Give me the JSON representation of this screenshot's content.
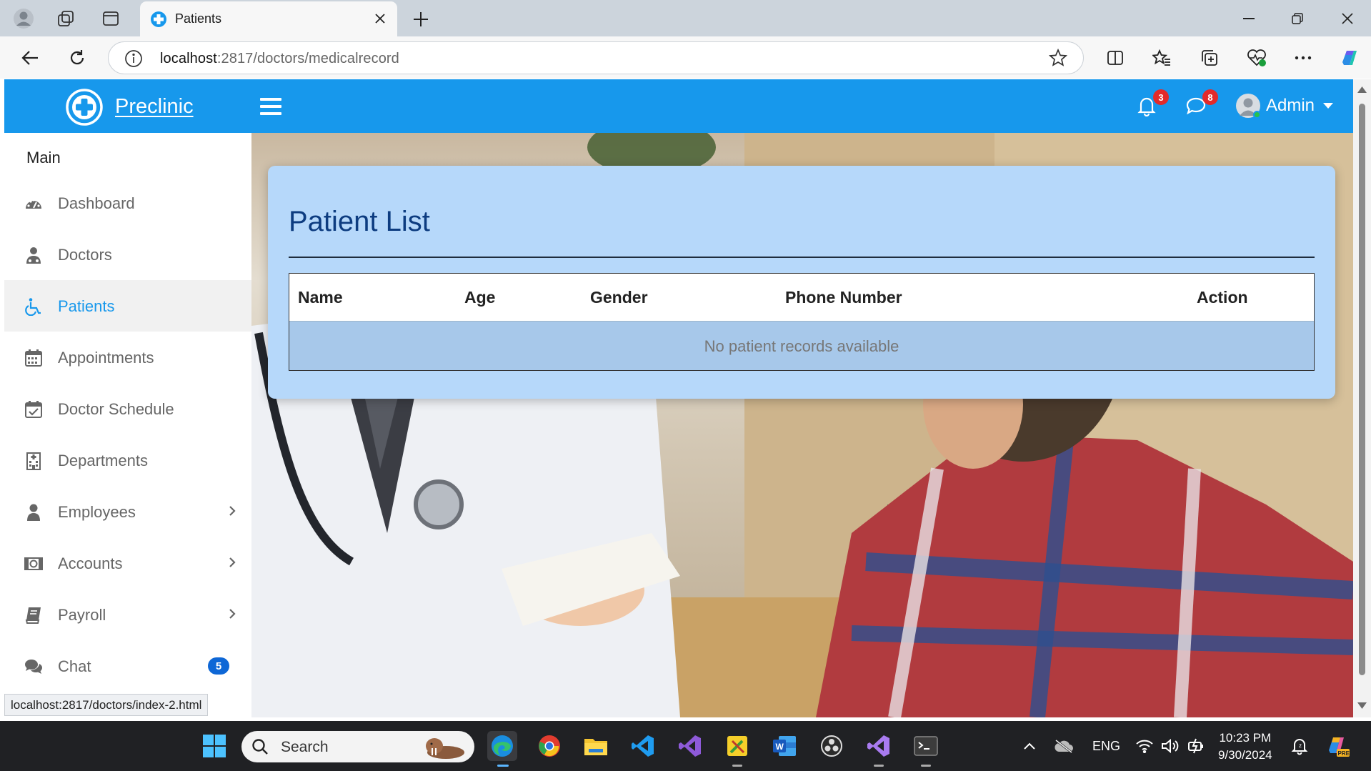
{
  "browser": {
    "tab_title": "Patients",
    "url_host": "localhost",
    "url_rest": ":2817/doctors/medicalrecord",
    "status_url": "localhost:2817/doctors/index-2.html"
  },
  "app": {
    "brand": "Preclinic",
    "notifications_count": "3",
    "messages_count": "8",
    "user_name": "Admin"
  },
  "sidebar": {
    "section_title": "Main",
    "items": [
      {
        "label": "Dashboard",
        "icon": "dashboard-icon"
      },
      {
        "label": "Doctors",
        "icon": "doctor-icon"
      },
      {
        "label": "Patients",
        "icon": "wheelchair-icon",
        "active": true
      },
      {
        "label": "Appointments",
        "icon": "calendar-icon"
      },
      {
        "label": "Doctor Schedule",
        "icon": "calendar-check-icon"
      },
      {
        "label": "Departments",
        "icon": "hospital-icon"
      },
      {
        "label": "Employees",
        "icon": "user-icon",
        "has_submenu": true
      },
      {
        "label": "Accounts",
        "icon": "money-icon",
        "has_submenu": true
      },
      {
        "label": "Payroll",
        "icon": "book-icon",
        "has_submenu": true
      },
      {
        "label": "Chat",
        "icon": "comments-icon",
        "badge": "5"
      }
    ]
  },
  "page": {
    "title": "Patient List",
    "columns": [
      "Name",
      "Age",
      "Gender",
      "Phone Number",
      "Action"
    ],
    "empty_message": "No patient records available"
  },
  "taskbar": {
    "search_placeholder": "Search",
    "language": "ENG",
    "time": "10:23 PM",
    "date": "9/30/2024"
  },
  "colors": {
    "accent": "#1798ec",
    "card_bg": "#b6d8fa",
    "title": "#0d3c80",
    "badge_red": "#e22a2a",
    "chat_badge": "#0e67d6"
  }
}
